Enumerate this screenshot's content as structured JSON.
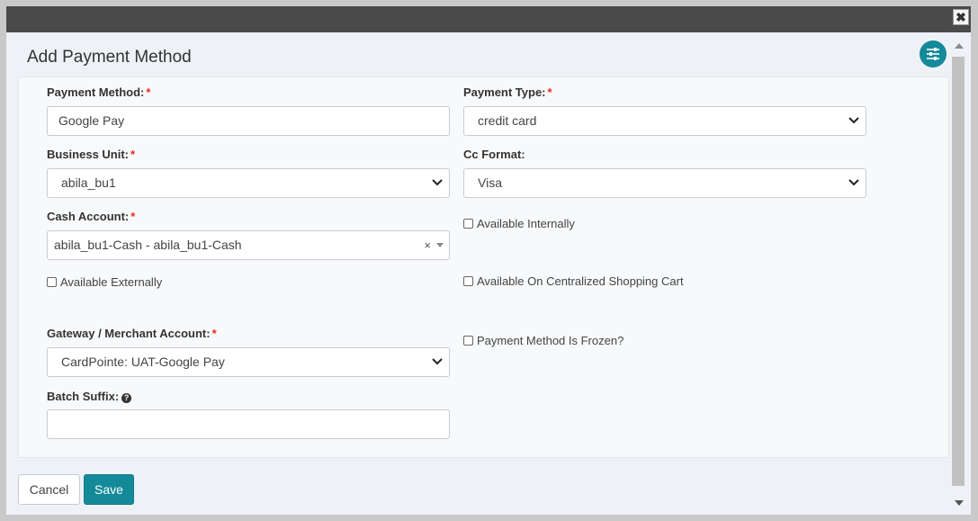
{
  "dialog": {
    "title": "Add Payment Method",
    "close_glyph": "✖"
  },
  "form": {
    "payment_method": {
      "label": "Payment Method:",
      "required": "*",
      "value": "Google Pay"
    },
    "payment_type": {
      "label": "Payment Type:",
      "required": "*",
      "value": "credit card"
    },
    "business_unit": {
      "label": "Business Unit:",
      "required": "*",
      "value": "abila_bu1"
    },
    "cc_format": {
      "label": "Cc Format:",
      "value": "Visa"
    },
    "cash_account": {
      "label": "Cash Account:",
      "required": "*",
      "value": "abila_bu1-Cash - abila_bu1-Cash",
      "clear_glyph": "×"
    },
    "available_internally": {
      "label": "Available Internally",
      "checked": false
    },
    "available_externally": {
      "label": "Available Externally",
      "checked": false
    },
    "available_centralized_cart": {
      "label": "Available On Centralized Shopping Cart",
      "checked": false
    },
    "gateway": {
      "label": "Gateway / Merchant Account:",
      "required": "*",
      "value": "CardPointe: UAT-Google Pay"
    },
    "frozen": {
      "label": "Payment Method Is Frozen?",
      "checked": false
    },
    "batch_suffix": {
      "label": "Batch Suffix:",
      "help_glyph": "?",
      "value": ""
    }
  },
  "footer": {
    "cancel_label": "Cancel",
    "save_label": "Save"
  },
  "colors": {
    "accent": "#148a99",
    "required": "#e0321c",
    "titlebar": "#4a4a4a"
  },
  "icons": {
    "settings": "sliders-icon",
    "close": "close-icon",
    "help": "question-circle-icon",
    "dropdown": "chevron-down-icon"
  }
}
